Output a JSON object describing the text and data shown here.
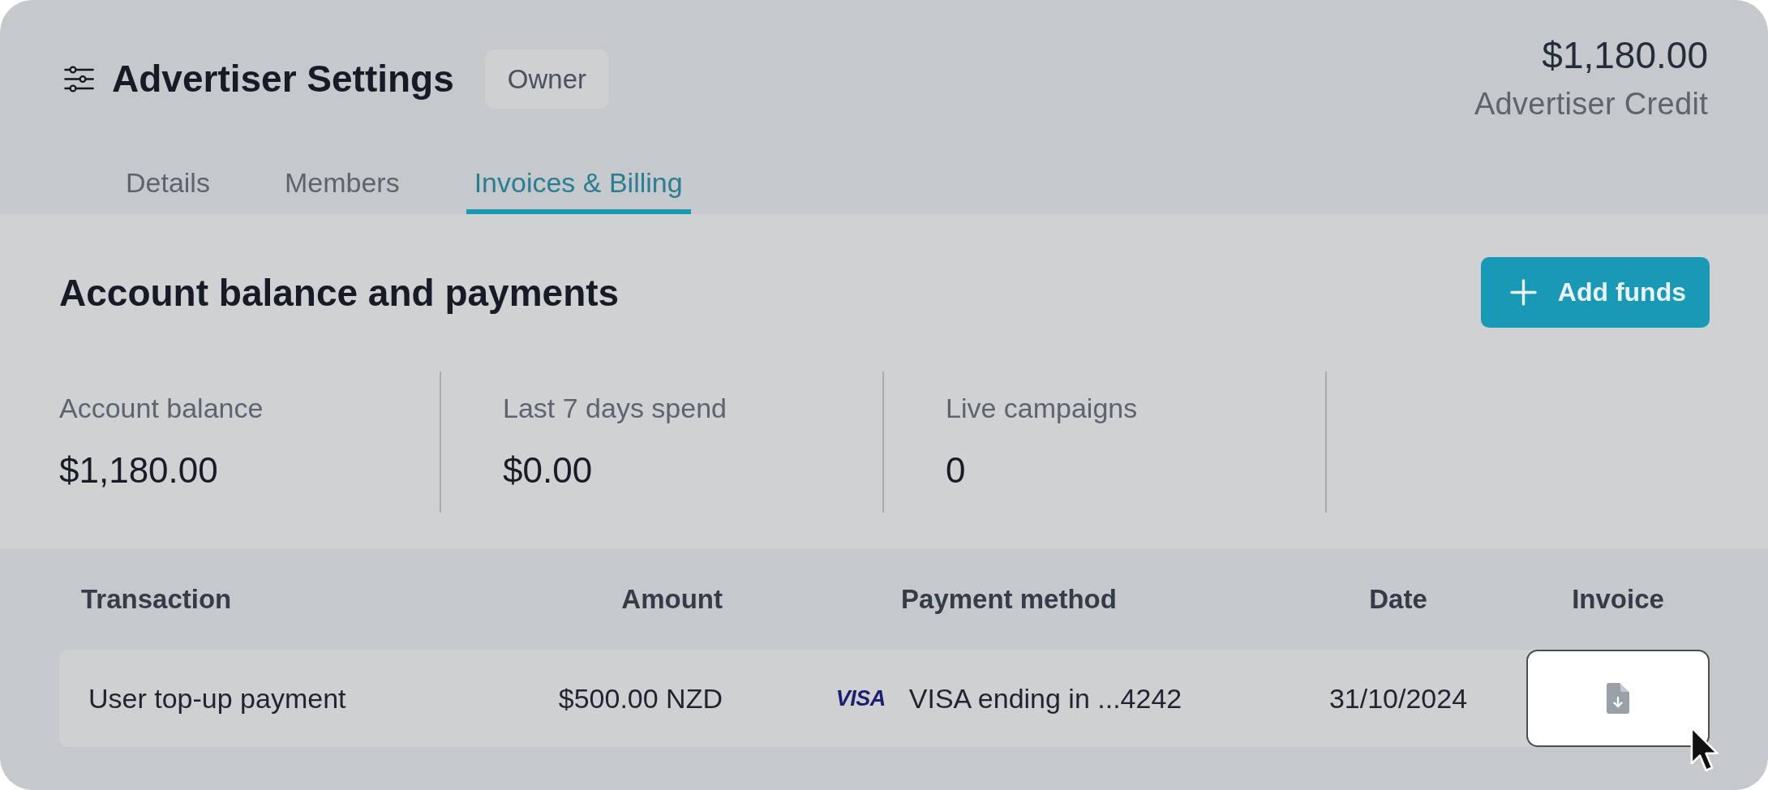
{
  "header": {
    "title": "Advertiser Settings",
    "badge": "Owner",
    "credit": {
      "amount": "$1,180.00",
      "label": "Advertiser Credit"
    }
  },
  "tabs": [
    {
      "label": "Details",
      "selected": false
    },
    {
      "label": "Members",
      "selected": false
    },
    {
      "label": "Invoices & Billing",
      "selected": true
    }
  ],
  "balance": {
    "title": "Account balance and payments",
    "button": "Add funds",
    "stats": [
      {
        "label": "Account balance",
        "value": "$1,180.00"
      },
      {
        "label": "Last 7 days spend",
        "value": "$0.00"
      },
      {
        "label": "Live campaigns",
        "value": "0"
      }
    ]
  },
  "table": {
    "columns": [
      "Transaction",
      "Amount",
      "Payment method",
      "Date",
      "Invoice"
    ],
    "rows": [
      {
        "transaction": "User top-up payment",
        "amount": "$500.00 NZD",
        "payment_method": {
          "card_logo": "VISA",
          "label": "VISA ending in ...4242"
        },
        "date": "31/10/2024",
        "invoice": {
          "hovered": true
        }
      }
    ]
  }
}
